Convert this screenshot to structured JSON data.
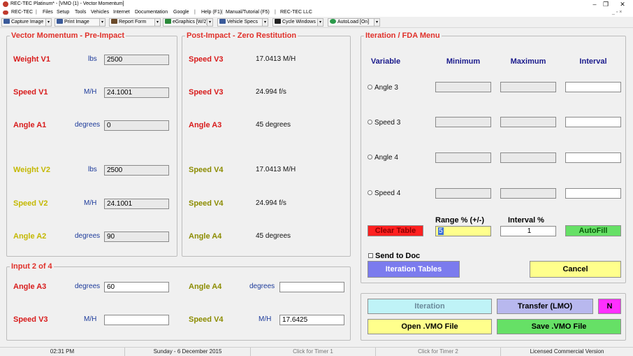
{
  "titlebar": {
    "title": "REC-TEC Platinum* - [VMO (1) - Vector Momentum]",
    "min": "–",
    "max": "❐",
    "close": "✕"
  },
  "menu": [
    "REC-TEC",
    "Files",
    "Setup",
    "Tools",
    "Vehicles",
    "Internet",
    "Documentation",
    "Google",
    "Help (F1)",
    "Manual/Tutorial (F5)",
    "REC-TEC LLC"
  ],
  "toolbar": {
    "capture": "Capture Image",
    "print": "Print Image",
    "report": "Report Form",
    "egraphics": "eGraphics [W/2]",
    "vehicle_specs": "Vehicle Specs",
    "cycle": "Cycle Windows",
    "autoload": "AutoLoad [On]"
  },
  "pre_impact": {
    "title": "Vector Momentum - Pre-Impact",
    "weight_v1": {
      "label": "Weight V1",
      "unit": "lbs",
      "value": "2500"
    },
    "speed_v1": {
      "label": "Speed V1",
      "unit": "M/H",
      "value": "24.1001"
    },
    "angle_a1": {
      "label": "Angle A1",
      "unit": "degrees",
      "value": "0"
    },
    "weight_v2": {
      "label": "Weight V2",
      "unit": "lbs",
      "value": "2500"
    },
    "speed_v2": {
      "label": "Speed V2",
      "unit": "M/H",
      "value": "24.1001"
    },
    "angle_a2": {
      "label": "Angle A2",
      "unit": "degrees",
      "value": "90"
    }
  },
  "post_impact": {
    "title": "Post-Impact - Zero Restitution",
    "speed_v3_mh": {
      "label": "Speed V3",
      "value": "17.0413  M/H"
    },
    "speed_v3_fs": {
      "label": "Speed V3",
      "value": "24.994  f/s"
    },
    "angle_a3": {
      "label": "Angle A3",
      "value": "45  degrees"
    },
    "speed_v4_mh": {
      "label": "Speed V4",
      "value": "17.0413  M/H"
    },
    "speed_v4_fs": {
      "label": "Speed V4",
      "value": "24.994  f/s"
    },
    "angle_a4": {
      "label": "Angle A4",
      "value": "45  degrees"
    }
  },
  "input": {
    "title": "Input 2 of 4",
    "angle_a3": {
      "label": "Angle A3",
      "unit": "degrees",
      "value": "60"
    },
    "angle_a4": {
      "label": "Angle A4",
      "unit": "degrees",
      "value": ""
    },
    "speed_v3": {
      "label": "Speed V3",
      "unit": "M/H",
      "value": ""
    },
    "speed_v4": {
      "label": "Speed V4",
      "unit": "M/H",
      "value": "17.6425"
    }
  },
  "iteration": {
    "title": "Iteration / FDA Menu",
    "headers": {
      "variable": "Variable",
      "minimum": "Minimum",
      "maximum": "Maximum",
      "interval": "Interval"
    },
    "rows": [
      "Angle 3",
      "Speed 3",
      "Angle 4",
      "Speed 4"
    ],
    "range_label": "Range % (+/-)",
    "interval_label": "Interval %",
    "clear_table": "Clear Table",
    "range_value": "5",
    "interval_value": "1",
    "autofill": "AutoFill",
    "send_to_doc": "Send to Doc",
    "iteration_tables": "Iteration Tables",
    "cancel": "Cancel"
  },
  "bottom_buttons": {
    "iteration": "Iteration",
    "transfer": "Transfer (LMO)",
    "n": "N",
    "open": "Open .VMO File",
    "save": "Save .VMO File"
  },
  "status": {
    "time": "02:31 PM",
    "date": "Sunday  -  6 December 2015",
    "timer1": "Click for Timer 1",
    "timer2": "Click for Timer 2",
    "license": "Licensed Commercial Version"
  },
  "colors": {
    "red_label": "#d81b1b",
    "yellow_label": "#c4b800",
    "blue_unit": "#1c3a9a",
    "btn_red": "#ff2020",
    "btn_green": "#66e066",
    "btn_blue": "#7b7bee",
    "btn_yellow": "#ffff8c",
    "btn_cyan": "#bff3f7",
    "btn_lavender": "#b8b8ee",
    "btn_magenta": "#ff30ff"
  }
}
